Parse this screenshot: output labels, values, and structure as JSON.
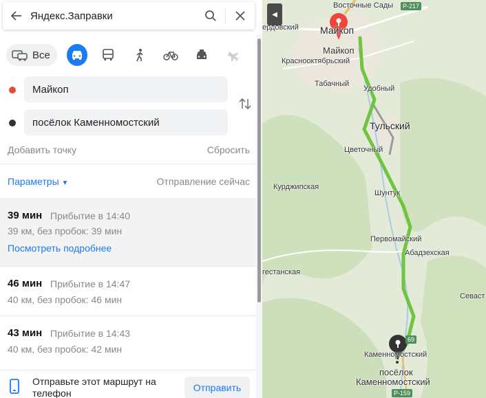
{
  "search": {
    "query": "Яндекс.Заправки"
  },
  "modes": {
    "all_label": "Все",
    "active": "car"
  },
  "route_points": {
    "from": "Майкоп",
    "to": "посёлок Каменномостский"
  },
  "actions": {
    "add_point": "Добавить точку",
    "reset": "Сбросить",
    "params": "Параметры",
    "departure": "Отправление сейчас"
  },
  "routes": [
    {
      "time": "39 мин",
      "arrival": "Прибытие в 14:40",
      "detail": "39 км, без пробок: 39 мин",
      "more": "Посмотреть подробнее"
    },
    {
      "time": "46 мин",
      "arrival": "Прибытие в 14:47",
      "detail": "40 км, без пробок: 46 мин"
    },
    {
      "time": "43 мин",
      "arrival": "Прибытие в 14:43",
      "detail": "40 км, без пробок: 42 мин"
    }
  ],
  "share": {
    "text": "Отправьте этот маршрут на телефон",
    "button": "Отправить"
  },
  "map": {
    "labels": {
      "vostochnye": "Восточные Сады",
      "r217": "Р-217",
      "ordovsky": "ердовский",
      "maykop_big": "Майкоп",
      "maykop_small": "Майкоп",
      "krasnooktyabrsky": "Краснооктябрьский",
      "tabachny": "Табачный",
      "udobny": "Удобный",
      "tulsky": "Тульский",
      "tsvetochny": "Цветочный",
      "kurdzhipskaya": "Курджипская",
      "shuntuk": "Шунтук",
      "pervomaysky": "Первомайский",
      "abadzekhskaya": "Абадзехская",
      "gestanskaya": "гестанская",
      "sevast": "Севаст",
      "r69": "69",
      "kamennomostsky": "Каменномостский",
      "dest_line1": "посёлок",
      "dest_line2": "Каменномостский",
      "r159": "Р-159"
    }
  },
  "colors": {
    "accent": "#1a7bf2",
    "route": "#6fc53f",
    "start_pin": "#f0463a",
    "end_pin": "#333333"
  }
}
